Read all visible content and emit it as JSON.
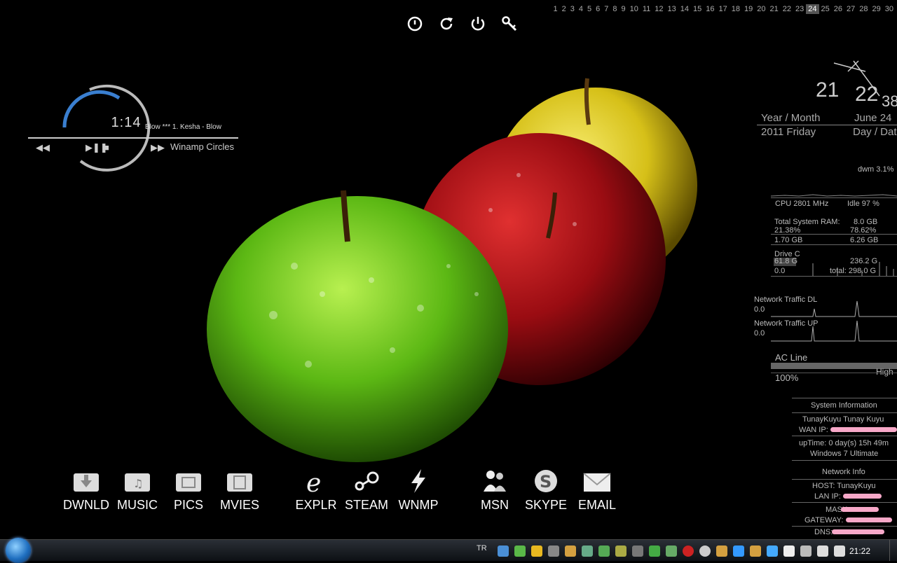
{
  "calendar": {
    "days": [
      "1",
      "2",
      "3",
      "4",
      "5",
      "6",
      "7",
      "8",
      "9",
      "10",
      "11",
      "12",
      "13",
      "14",
      "15",
      "16",
      "17",
      "18",
      "19",
      "20",
      "21",
      "22",
      "23",
      "24",
      "25",
      "26",
      "27",
      "28",
      "29",
      "30"
    ],
    "today": "24"
  },
  "top_icons": [
    "shutdown-icon",
    "restart-icon",
    "power-icon",
    "key-icon"
  ],
  "winamp": {
    "time": "1:14",
    "track": "Blow *** 1. Kesha - Blow",
    "name": "Winamp Circles",
    "prev": "◀◀",
    "playpause": "▶❚❚",
    "stop": "■",
    "next": "▶▶"
  },
  "clock": {
    "hour": "21",
    "minute": "22",
    "second": "38",
    "year_month_label": "Year / Month",
    "month_day": "June 24",
    "year_weekday": "2011 Friday",
    "day_date_label": "Day / Date"
  },
  "system": {
    "top_process": "dwm 3.1%",
    "cpu": "CPU 2801 MHz",
    "idle": "Idle 97 %",
    "ram_label": "Total System RAM:",
    "ram_total": "8.0 GB",
    "ram_used_pct": "21.38%",
    "ram_free_pct": "78.62%",
    "ram_used": "1.70 GB",
    "ram_free": "6.26 GB",
    "drive_label": "Drive C",
    "drive_used": "61.8 G",
    "drive_free": "236.2 G",
    "drive_zero": "0.0",
    "drive_total": "total: 298.0 G",
    "net_dl_label": "Network Traffic DL",
    "net_dl_val": "0.0",
    "net_up_label": "Network Traffic UP",
    "net_up_val": "0.0",
    "power_label": "AC Line",
    "power_level": "High",
    "power_pct": "100%"
  },
  "sysinfo": {
    "title": "System Information",
    "user": "TunayKuyu  Tunay Kuyu",
    "wan": "WAN IP:",
    "uptime": "upTime: 0 day(s) 15h 49m",
    "os": "Windows 7 Ultimate"
  },
  "netinfo": {
    "title": "Network Info",
    "host": "HOST: TunayKuyu",
    "lan": "LAN IP:",
    "mask": "MASK:",
    "gateway": "GATEWAY:",
    "dns": "DNS:"
  },
  "dock": {
    "left": [
      "DWNLD",
      "MUSIC",
      "PICS",
      "MVIES"
    ],
    "mid": [
      "EXPLR",
      "STEAM",
      "WNMP"
    ],
    "right": [
      "MSN",
      "SKYPE",
      "EMAIL"
    ]
  },
  "taskbar": {
    "lang": "TR",
    "clock": "21:22"
  },
  "colors": {
    "apple_green": "#6dc21a",
    "apple_red": "#b0121a",
    "apple_yellow": "#e8d21c",
    "accent_blue": "#3a7fd0",
    "redact_pink": "#f7a8c8"
  }
}
